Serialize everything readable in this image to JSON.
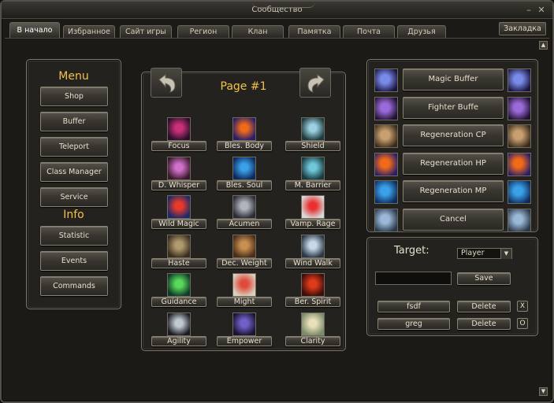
{
  "window": {
    "title": "Сообщество",
    "minimize_glyph": "–",
    "close_glyph": "✕"
  },
  "tabs": [
    {
      "label": "В начало",
      "active": true
    },
    {
      "label": "Избранное"
    },
    {
      "label": "Сайт игры"
    },
    {
      "label": "Регион"
    },
    {
      "label": "Клан"
    },
    {
      "label": "Памятка"
    },
    {
      "label": "Почта"
    },
    {
      "label": "Друзья"
    }
  ],
  "bookmark_label": "Закладка",
  "scroll_up_glyph": "▲",
  "scroll_down_glyph": "▼",
  "menu": {
    "heading": "Menu",
    "items": [
      "Shop",
      "Buffer",
      "Teleport",
      "Class Manager",
      "Service"
    ],
    "info_heading": "Info",
    "info_items": [
      "Statistic",
      "Events",
      "Commands"
    ]
  },
  "page": {
    "title": "Page #1",
    "skills": [
      {
        "label": "Focus",
        "icon": "focus-icon",
        "c1": "#c8307a",
        "c2": "#2a0e2a"
      },
      {
        "label": "Bles. Body",
        "icon": "blessed-body-icon",
        "c1": "#f06a1a",
        "c2": "#2a1e6a"
      },
      {
        "label": "Shield",
        "icon": "shield-icon",
        "c1": "#9ad0e0",
        "c2": "#1e3a3e"
      },
      {
        "label": "D. Whisper",
        "icon": "death-whisper-icon",
        "c1": "#d070c8",
        "c2": "#3a1a2a"
      },
      {
        "label": "Bles. Soul",
        "icon": "blessed-soul-icon",
        "c1": "#3aa0e8",
        "c2": "#0e2a5a"
      },
      {
        "label": "M. Barrier",
        "icon": "magic-barrier-icon",
        "c1": "#6fc8d8",
        "c2": "#1a3a40"
      },
      {
        "label": "Wild Magic",
        "icon": "wild-magic-icon",
        "c1": "#e83a2a",
        "c2": "#1a2a6a"
      },
      {
        "label": "Acumen",
        "icon": "acumen-icon",
        "c1": "#b0b4bc",
        "c2": "#2a2c36"
      },
      {
        "label": "Vamp. Rage",
        "icon": "vampiric-rage-icon",
        "c1": "#e83030",
        "c2": "#d8d8d8"
      },
      {
        "label": "Haste",
        "icon": "haste-icon",
        "c1": "#b09a70",
        "c2": "#3a2e1e"
      },
      {
        "label": "Dec. Weight",
        "icon": "decrease-weight-icon",
        "c1": "#c89050",
        "c2": "#4a2e1a"
      },
      {
        "label": "Wind Walk",
        "icon": "wind-walk-icon",
        "c1": "#c8d8e8",
        "c2": "#2a3848"
      },
      {
        "label": "Guidance",
        "icon": "guidance-icon",
        "c1": "#5ad85a",
        "c2": "#0e3a2a"
      },
      {
        "label": "Might",
        "icon": "might-icon",
        "c1": "#e04a3a",
        "c2": "#d8d0c0"
      },
      {
        "label": "Ber. Spirit",
        "icon": "berserker-spirit-icon",
        "c1": "#e03a1a",
        "c2": "#3a0e0a"
      },
      {
        "label": "Agility",
        "icon": "agility-icon",
        "c1": "#c0c8d0",
        "c2": "#1a1c22"
      },
      {
        "label": "Empower",
        "icon": "empower-icon",
        "c1": "#7060c8",
        "c2": "#1a1430"
      },
      {
        "label": "Clarity",
        "icon": "clarity-icon",
        "c1": "#e8e0b8",
        "c2": "#7a8a6a"
      }
    ]
  },
  "buffs": [
    {
      "label": "Magic Buffer",
      "icon": "magic-buffer-icon",
      "c1": "#7a8ae8",
      "c2": "#1a1440"
    },
    {
      "label": "Fighter Buffe",
      "icon": "fighter-buffer-icon",
      "c1": "#9a6ad8",
      "c2": "#201030"
    },
    {
      "label": "Regeneration CP",
      "icon": "regeneration-cp-icon",
      "c1": "#c8a070",
      "c2": "#3a2a1a"
    },
    {
      "label": "Regeneration HP",
      "icon": "regeneration-hp-icon",
      "c1": "#f06a1a",
      "c2": "#2a1e6a"
    },
    {
      "label": "Regeneration MP",
      "icon": "regeneration-mp-icon",
      "c1": "#3aa0e8",
      "c2": "#0e2a5a"
    },
    {
      "label": "Cancel",
      "icon": "cancel-icon",
      "c1": "#9ab8d8",
      "c2": "#2a3848"
    }
  ],
  "target": {
    "label": "Target:",
    "select_value": "Player",
    "name_value": "",
    "save_label": "Save",
    "profiles": [
      {
        "name": "fsdf",
        "delete_label": "Delete",
        "action_glyph": "X"
      },
      {
        "name": "greg",
        "delete_label": "Delete",
        "action_glyph": "O"
      }
    ]
  }
}
